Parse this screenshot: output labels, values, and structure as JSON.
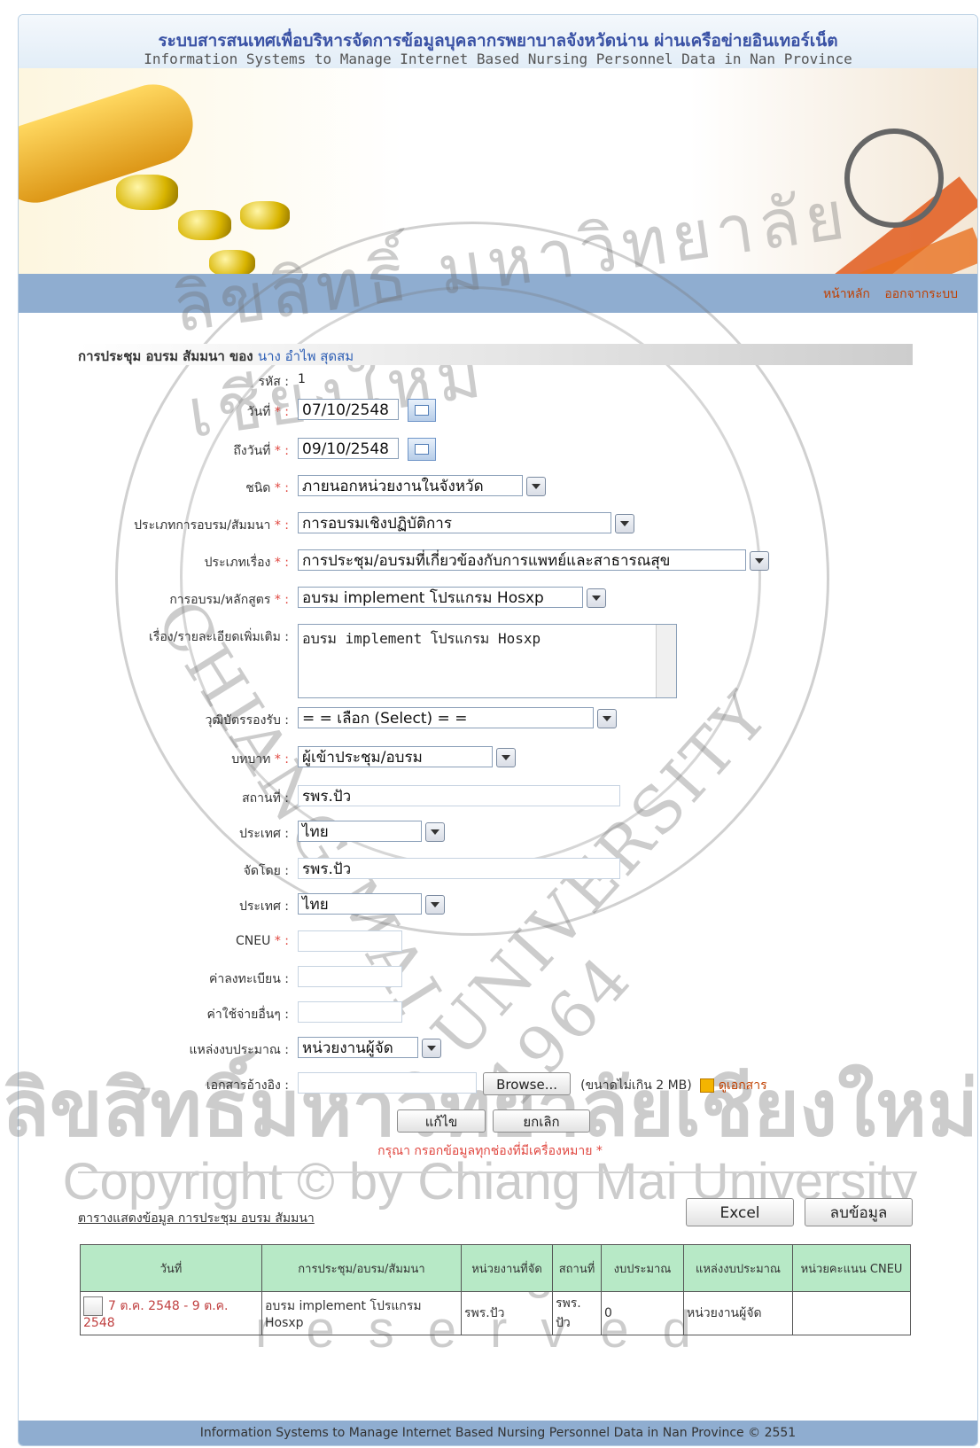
{
  "header": {
    "title_th": "ระบบสารสนเทศเพื่อบริหารจัดการข้อมูลบุคลากรพยาบาลจังหวัดน่าน ผ่านเครือข่ายอินเทอร์เน็ต",
    "title_en": "Information Systems to Manage Internet Based Nursing Personnel Data  in Nan Province"
  },
  "nav": {
    "home": "หน้าหลัก",
    "logout": "ออกจากระบบ"
  },
  "section": {
    "title": "การประชุม อบรม สัมมนา ของ ",
    "person": "นาง อำไพ สุดสม"
  },
  "form": {
    "id_label": "รหัส :",
    "id_value": "1",
    "date_label": "วันที่",
    "date_value": "07/10/2548",
    "to_date_label": "ถึงวันที่",
    "to_date_value": "09/10/2548",
    "kind_label": "ชนิด",
    "kind_value": "ภายนอกหน่วยงานในจังหวัด",
    "training_type_label": "ประเภทการอบรม/สัมมนา",
    "training_type_value": "การอบรมเชิงปฏิบัติการ",
    "topic_type_label": "ประเภทเรื่อง",
    "topic_type_value": "การประชุม/อบรมที่เกี่ยวข้องกับการแพทย์และสาธารณสุข",
    "course_label": "การอบรม/หลักสูตร",
    "course_value": "อบรม implement โปรแกรม Hosxp",
    "detail_label": "เรื่อง/รายละเอียดเพิ่มเติม :",
    "detail_value": "อบรม implement โปรแกรม Hosxp",
    "certificate_label": "วุฒิบัตรรองรับ :",
    "certificate_value": "= = เลือก (Select) = =",
    "role_label": "บทบาท",
    "role_value": "ผู้เข้าประชุม/อบรม",
    "place_label": "สถานที่ :",
    "place_value": "รพร.ปัว",
    "country_label": "ประเทศ :",
    "country_value": "ไทย",
    "organizer_label": "จัดโดย :",
    "organizer_value": "รพร.ปัว",
    "country2_label": "ประเทศ :",
    "country2_value": "ไทย",
    "cneu_label": "CNEU",
    "cneu_value": "",
    "reg_fee_label": "ค่าลงทะเบียน :",
    "reg_fee_value": "",
    "other_cost_label": "ค่าใช้จ่ายอื่นๆ :",
    "other_cost_value": "",
    "budget_source_label": "แหล่งงบประมาณ :",
    "budget_source_value": "หน่วยงานผู้จัด",
    "doc_label": "เอกสารอ้างอิง :",
    "browse_label": "Browse...",
    "size_note": "(ขนาดไม่เกิน 2 MB)",
    "view_doc": "ดูเอกสาร",
    "edit_button": "แก้ไข",
    "cancel_button": "ยกเลิก",
    "required_note": "กรุณา กรอกข้อมูลทุกช่องที่มีเครื่องหมาย *",
    "req_mark": " * :"
  },
  "table": {
    "title": "ตารางแสดงข้อมูล การประชุม อบรม สัมมนา",
    "excel_button": "Excel",
    "delete_button": "ลบข้อมูล",
    "headers": [
      "วันที่",
      "การประชุม/อบรม/สัมมนา",
      "หน่วยงานที่จัด",
      "สถานที่",
      "งบประมาณ",
      "แหล่งงบประมาณ",
      "หน่วยคะแนน CNEU"
    ],
    "rows": [
      [
        "7 ต.ค. 2548 - 9 ต.ค. 2548",
        "อบรม implement โปรแกรม Hosxp",
        "รพร.ปัว",
        "รพร. ปัว",
        "0",
        "หน่วยงานผู้จัด",
        ""
      ]
    ]
  },
  "watermark": {
    "arc_top": "ลิขสิทธิ์ มหาวิทยาลัยเชียงใหม่",
    "arc_left": "CHIANG MAI",
    "arc_right": "UNIVERSITY 1964",
    "line1": "ลิขสิทธิ์มหาวิทยาลัยเชียงใหม่",
    "line2": "Copyright © by Chiang Mai University",
    "line3": "All rights reserved"
  },
  "footer": {
    "text": "Information Systems to Manage Internet Based Nursing Personnel Data in Nan Province © 2551"
  }
}
